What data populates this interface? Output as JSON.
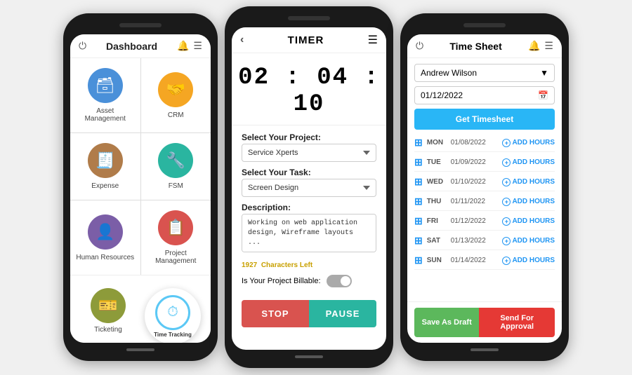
{
  "phone1": {
    "header": {
      "title": "Dashboard",
      "power_icon": "⏻",
      "bell_icon": "🔔",
      "menu_icon": "☰"
    },
    "grid": [
      {
        "label": "Asset Management",
        "icon": "🗃",
        "color": "icon-blue"
      },
      {
        "label": "CRM",
        "icon": "🤝",
        "color": "icon-orange"
      },
      {
        "label": "Expense",
        "icon": "🧾",
        "color": "icon-brown"
      },
      {
        "label": "FSM",
        "icon": "🔧",
        "color": "icon-teal"
      },
      {
        "label": "Human Resources",
        "icon": "👤",
        "color": "icon-purple"
      },
      {
        "label": "Project Management",
        "icon": "📋",
        "color": "icon-red"
      }
    ],
    "ticketing": {
      "label": "Ticketing",
      "icon": "🎫",
      "color": "icon-olive"
    },
    "time_tracking": {
      "label": "Time Tracking"
    }
  },
  "phone2": {
    "header": {
      "title": "TIMER",
      "back_icon": "‹",
      "menu_icon": "☰"
    },
    "timer_display": "02 : 04 : 10",
    "form": {
      "project_label": "Select Your Project:",
      "project_value": "Service Xperts",
      "task_label": "Select Your Task:",
      "task_value": "Screen Design",
      "description_label": "Description:",
      "description_value": "Working on web application design, Wireframe layouts ...",
      "chars_left": "1927",
      "chars_left_label": "Characters Left",
      "billable_label": "Is Your Project Billable:",
      "toggle_value": "No"
    },
    "buttons": {
      "stop": "STOP",
      "pause": "PAUSE"
    }
  },
  "phone3": {
    "header": {
      "title": "Time Sheet",
      "power_icon": "⏻",
      "bell_icon": "🔔",
      "menu_icon": "☰"
    },
    "user": "Andrew Wilson",
    "date": "01/12/2022",
    "get_timesheet_btn": "Get Timesheet",
    "rows": [
      {
        "day": "MON",
        "date": "01/08/2022"
      },
      {
        "day": "TUE",
        "date": "01/09/2022"
      },
      {
        "day": "WED",
        "date": "01/10/2022"
      },
      {
        "day": "THU",
        "date": "01/11/2022"
      },
      {
        "day": "FRI",
        "date": "01/12/2022"
      },
      {
        "day": "SAT",
        "date": "01/13/2022"
      },
      {
        "day": "SUN",
        "date": "01/14/2022"
      }
    ],
    "add_hours_label": "ADD HOURS",
    "footer": {
      "save_draft": "Save As Draft",
      "send_approval": "Send For Approval"
    }
  }
}
